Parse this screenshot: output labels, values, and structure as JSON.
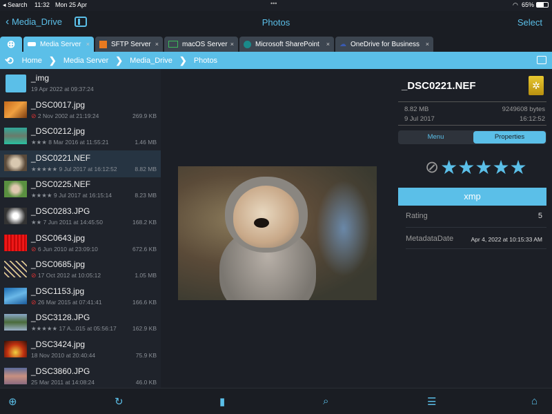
{
  "status": {
    "back": "◂ Search",
    "time": "11:32",
    "date": "Mon 25 Apr",
    "battery": "65%"
  },
  "nav": {
    "back_label": "Media_Drive",
    "title": "Photos",
    "select": "Select"
  },
  "tabs": [
    {
      "label": "Media Server",
      "icon": "drive-icon",
      "active": true
    },
    {
      "label": "SFTP Server",
      "icon": "sftp-icon"
    },
    {
      "label": "macOS Server",
      "icon": "monitor-icon"
    },
    {
      "label": "Microsoft SharePoint",
      "icon": "sharepoint-icon"
    },
    {
      "label": "OneDrive for Business",
      "icon": "onedrive-icon"
    }
  ],
  "breadcrumb": [
    "Home",
    "Media Server",
    "Media_Drive",
    "Photos"
  ],
  "files": [
    {
      "name": "_img",
      "meta": "19 Apr 2022 at 09:37:24",
      "size": "",
      "rating": "",
      "folder": true
    },
    {
      "name": "_DSC0017.jpg",
      "meta": "2 Nov 2002 at 21:19:24",
      "size": "269.9 KB",
      "rating": "⊘",
      "thumb": "linear-gradient(135deg,#c76a1c,#f0a040,#7a3b10)"
    },
    {
      "name": "_DSC0212.jpg",
      "meta": "8 Mar 2016 at 11:55:21",
      "size": "1.46 MB",
      "rating": "★★★",
      "thumb": "linear-gradient(180deg,#2fa99a,#6a7a6a,#28c0a0)"
    },
    {
      "name": "_DSC0221.NEF",
      "meta": "9 Jul 2017 at 16:12:52",
      "size": "8.82 MB",
      "rating": "★★★★★",
      "thumb": "radial-gradient(circle at 50% 50%,#d8c8b0 30%,#5a4a3a 70%)"
    },
    {
      "name": "_DSC0225.NEF",
      "meta": "9 Jul 2017 at 16:15:14",
      "size": "8.23 MB",
      "rating": "★★★★",
      "thumb": "radial-gradient(circle,#e0c8b0 25%,#5a9040 60%)"
    },
    {
      "name": "_DSC0283.JPG",
      "meta": "7 Jun 2011 at 14:45:50",
      "size": "168.2 KB",
      "rating": "★★",
      "thumb": "radial-gradient(circle,#fff 20%,#333 70%)"
    },
    {
      "name": "_DSC0643.jpg",
      "meta": "6 Jun 2010 at 23:09:10",
      "size": "672.6 KB",
      "rating": "⊘",
      "thumb": "repeating-linear-gradient(90deg,#c00,#f22 3px,#900 5px)"
    },
    {
      "name": "_DSC0685.jpg",
      "meta": "17 Oct 2012 at 10:05:12",
      "size": "1.05 MB",
      "rating": "⊘",
      "thumb": "repeating-linear-gradient(45deg,#223 0 4px,#dcc890 4px 6px)"
    },
    {
      "name": "_DSC1153.jpg",
      "meta": "26 Mar 2015 at 07:41:41",
      "size": "166.6 KB",
      "rating": "⊘",
      "thumb": "linear-gradient(160deg,#1a6ab0,#6ab8e8,#1a5a9a)"
    },
    {
      "name": "_DSC3128.JPG",
      "meta": "17 A...015 at 05:56:17",
      "size": "162.9 KB",
      "rating": "★★★★★",
      "thumb": "linear-gradient(180deg,#8aa8c8,#4a6a3a 50%,#9ab0c8)"
    },
    {
      "name": "_DSC3424.jpg",
      "meta": "18 Nov 2010 at 20:40:44",
      "size": "75.9 KB",
      "rating": "",
      "thumb": "radial-gradient(circle at 50% 70%,#f0d040,#c03010 50%,#301008)"
    },
    {
      "name": "_DSC3860.JPG",
      "meta": "25 Mar 2011 at 14:08:24",
      "size": "46.0 KB",
      "rating": "",
      "thumb": "linear-gradient(180deg,#5a6a9a,#c89080,#8a6a80)"
    }
  ],
  "selected_index": 3,
  "details": {
    "name": "_DSC0221.NEF",
    "size": "8.82 MB",
    "bytes": "9249608 bytes",
    "date": "9 Jul 2017",
    "time": "16:12:52",
    "tab_menu": "Menu",
    "tab_properties": "Properties",
    "rating_value": 5,
    "section": "xmp",
    "props": [
      {
        "key": "Rating",
        "value": "5"
      },
      {
        "key": "MetadataDate",
        "value": "Apr 4, 2022 at 10:15:33 AM"
      }
    ]
  },
  "colors": {
    "accent": "#5bbfe8",
    "background": "#1c1f26"
  }
}
